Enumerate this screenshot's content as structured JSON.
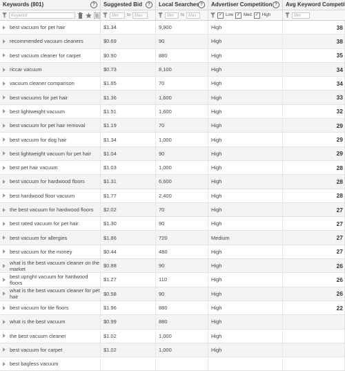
{
  "columns": {
    "keywords": "Keywords (801)",
    "bid": "Suggested Bid",
    "searches": "Local Searches",
    "competition": "Advertiser Competition",
    "avg": "Avg Keyword Competition"
  },
  "filters": {
    "keyword_placeholder": "Keyword",
    "min_placeholder": "Min",
    "max_placeholder": "Max",
    "to": "to",
    "low": "Low",
    "med": "Med",
    "high": "High"
  },
  "rows": [
    {
      "keyword": "best vacuum for pet hair",
      "bid": "$1.34",
      "searches": "9,900",
      "competition": "High",
      "avg": "38"
    },
    {
      "keyword": "recommended vacuum cleaners",
      "bid": "$0.69",
      "searches": "90",
      "competition": "High",
      "avg": "38"
    },
    {
      "keyword": "best vacuum cleaner for carpet",
      "bid": "$0.90",
      "searches": "880",
      "competition": "High",
      "avg": "35"
    },
    {
      "keyword": "riccar vacuum",
      "bid": "$0.73",
      "searches": "8,100",
      "competition": "High",
      "avg": "34"
    },
    {
      "keyword": "vacuum cleaner comparison",
      "bid": "$1.65",
      "searches": "70",
      "competition": "High",
      "avg": "34"
    },
    {
      "keyword": "best vacuums for pet hair",
      "bid": "$1.36",
      "searches": "1,600",
      "competition": "High",
      "avg": "33"
    },
    {
      "keyword": "best lightweight vacuum",
      "bid": "$1.51",
      "searches": "1,600",
      "competition": "High",
      "avg": "32"
    },
    {
      "keyword": "best vacuum for pet hair removal",
      "bid": "$1.19",
      "searches": "70",
      "competition": "High",
      "avg": "29"
    },
    {
      "keyword": "best vacuum for dog hair",
      "bid": "$1.34",
      "searches": "1,000",
      "competition": "High",
      "avg": "29"
    },
    {
      "keyword": "best lightweight vacuum for pet hair",
      "bid": "$1.04",
      "searches": "90",
      "competition": "High",
      "avg": "29"
    },
    {
      "keyword": "best pet hair vacuum",
      "bid": "$1.03",
      "searches": "1,000",
      "competition": "High",
      "avg": "28"
    },
    {
      "keyword": "best vacuum for hardwood floors",
      "bid": "$1.31",
      "searches": "6,600",
      "competition": "High",
      "avg": "28"
    },
    {
      "keyword": "best hardwood floor vacuum",
      "bid": "$1.77",
      "searches": "2,400",
      "competition": "High",
      "avg": "28"
    },
    {
      "keyword": "the best vacuum for hardwood floors",
      "bid": "$2.02",
      "searches": "70",
      "competition": "High",
      "avg": "27"
    },
    {
      "keyword": "best rated vacuum for pet hair",
      "bid": "$1.30",
      "searches": "90",
      "competition": "High",
      "avg": "27"
    },
    {
      "keyword": "best vacuum for allergies",
      "bid": "$1.86",
      "searches": "720",
      "competition": "Medium",
      "avg": "27"
    },
    {
      "keyword": "best vacuum for the money",
      "bid": "$0.44",
      "searches": "480",
      "competition": "High",
      "avg": "27"
    },
    {
      "keyword": "what is the best vacuum cleaner on the market",
      "bid": "$0.88",
      "searches": "90",
      "competition": "High",
      "avg": "26"
    },
    {
      "keyword": "best upright vacuum for hardwood floors",
      "bid": "$1.27",
      "searches": "110",
      "competition": "High",
      "avg": "26"
    },
    {
      "keyword": "what is the best vacuum cleaner for pet hair",
      "bid": "$0.58",
      "searches": "90",
      "competition": "High",
      "avg": "26"
    },
    {
      "keyword": "best vacuum for tile floors",
      "bid": "$1.96",
      "searches": "880",
      "competition": "High",
      "avg": "22"
    },
    {
      "keyword": "what is the best vacuum",
      "bid": "$0.99",
      "searches": "880",
      "competition": "High",
      "avg": ""
    },
    {
      "keyword": "the best vacuum cleaner",
      "bid": "$1.02",
      "searches": "1,000",
      "competition": "High",
      "avg": ""
    },
    {
      "keyword": "best vacuum for carpet",
      "bid": "$1.02",
      "searches": "1,000",
      "competition": "High",
      "avg": ""
    },
    {
      "keyword": "best bagless vacuum",
      "bid": "",
      "searches": "",
      "competition": "",
      "avg": ""
    }
  ]
}
